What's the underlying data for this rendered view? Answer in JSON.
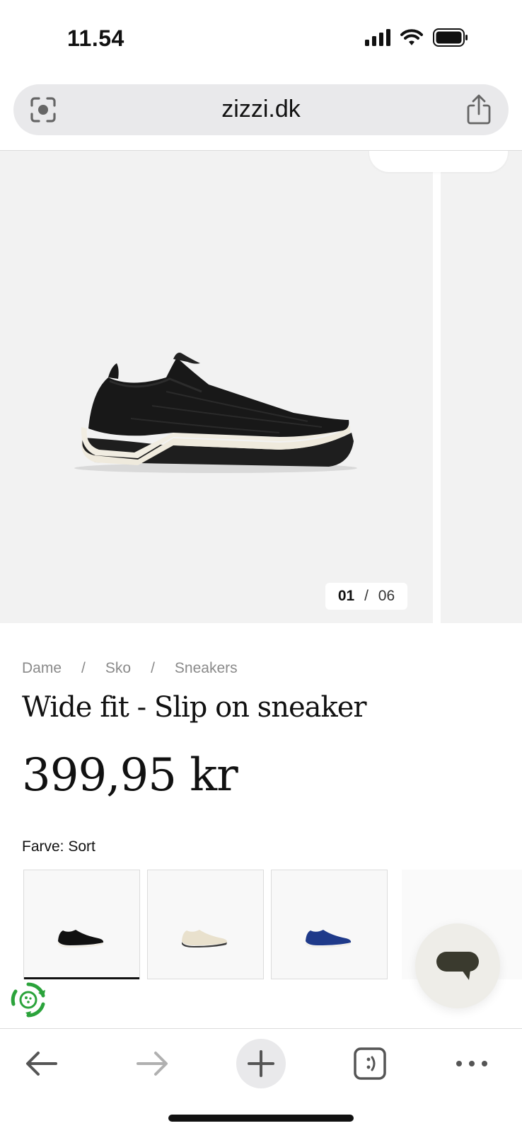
{
  "status_bar": {
    "time": "11.54",
    "icons": [
      "signal-icon",
      "wifi-icon",
      "battery-icon"
    ]
  },
  "browser": {
    "url": "zizzi.dk",
    "left_icon": "lens-scan-icon",
    "right_icon": "share-icon"
  },
  "gallery": {
    "current": "01",
    "separator": "/",
    "total": "06"
  },
  "breadcrumb": {
    "items": [
      "Dame",
      "Sko",
      "Sneakers"
    ],
    "separator": "/"
  },
  "product": {
    "title": "Wide fit - Slip on sneaker",
    "price": "399,95 kr",
    "color_label": "Farve: Sort"
  },
  "swatches": [
    {
      "color": "#111111",
      "sole": "#f1ede4",
      "selected": true
    },
    {
      "color": "#e9e1cd",
      "sole": "#f3f0ea",
      "selected": false
    },
    {
      "color": "#1f3a8a",
      "sole": "#f1efe9",
      "selected": false
    }
  ],
  "colors": {
    "gallery_bg": "#f2f2f2",
    "chat_bg": "#eeede8",
    "chat_icon": "#3a3a2e",
    "eco_green": "#2ba33b"
  },
  "toolbar": {
    "icons": [
      "back-arrow-icon",
      "forward-arrow-icon",
      "new-tab-plus-icon",
      "tabs-icon",
      "more-icon"
    ]
  }
}
